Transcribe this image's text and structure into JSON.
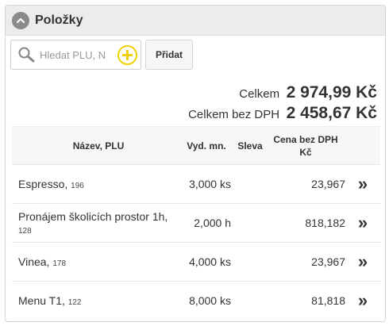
{
  "panel": {
    "title": "Položky"
  },
  "search": {
    "placeholder": "Hledat PLU, N"
  },
  "toolbar": {
    "add_label": "Přidat"
  },
  "totals": {
    "total_label": "Celkem",
    "total_value": "2 974,99 Kč",
    "total_net_label": "Celkem bez DPH",
    "total_net_value": "2 458,67 Kč"
  },
  "table": {
    "headers": {
      "name": "Název, PLU",
      "qty": "Vyd. mn.",
      "discount": "Sleva",
      "price": "Cena bez DPH Kč"
    },
    "rows": [
      {
        "name": "Espresso,",
        "plu": "196",
        "qty": "3,000",
        "unit": "ks",
        "discount": "",
        "price": "23,967",
        "arrow": "»"
      },
      {
        "name": "Pronájem školicích prostor 1h,",
        "plu": "128",
        "qty": "2,000",
        "unit": "h",
        "discount": "",
        "price": "818,182",
        "arrow": "»"
      },
      {
        "name": "Vinea,",
        "plu": "178",
        "qty": "4,000",
        "unit": "ks",
        "discount": "",
        "price": "23,967",
        "arrow": "»"
      },
      {
        "name": "Menu T1,",
        "plu": "122",
        "qty": "8,000",
        "unit": "ks",
        "discount": "",
        "price": "81,818",
        "arrow": "»"
      }
    ]
  },
  "icons": {
    "collapse": "chevron-up-icon",
    "search": "magnifier-icon",
    "add": "plus-circle-icon",
    "row_detail": "double-chevron-right-icon"
  },
  "colors": {
    "accent_yellow": "#f0d000",
    "header_bg": "#ececec"
  }
}
